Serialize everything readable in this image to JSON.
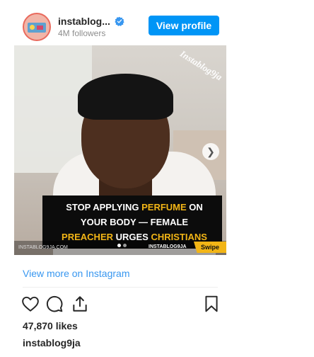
{
  "header": {
    "username": "instablog...",
    "followers": "4M followers",
    "view_profile_label": "View profile"
  },
  "media": {
    "watermark": "Instablog9ja",
    "caption_lines": [
      {
        "parts": [
          "STOP APPLYING ",
          "PERFUME",
          " ON"
        ]
      },
      {
        "parts": [
          "YOUR BODY — FEMALE"
        ]
      },
      {
        "parts": [
          "PREACHER",
          " URGES ",
          "CHRISTIANS"
        ]
      }
    ],
    "site_left": "INSTABLOG9JA.COM",
    "site_right": "INSTABLOG9JA",
    "swipe": "Swipe",
    "highlight_color": "#f2b516"
  },
  "footer": {
    "view_more": "View more on Instagram",
    "likes": "47,870 likes",
    "owner": "instablog9ja"
  },
  "colors": {
    "primary_button": "#0095f6",
    "link": "#3897f0"
  },
  "icons": [
    "heart-icon",
    "comment-icon",
    "share-icon",
    "bookmark-icon",
    "chevron-right-icon",
    "verified-badge-icon"
  ]
}
